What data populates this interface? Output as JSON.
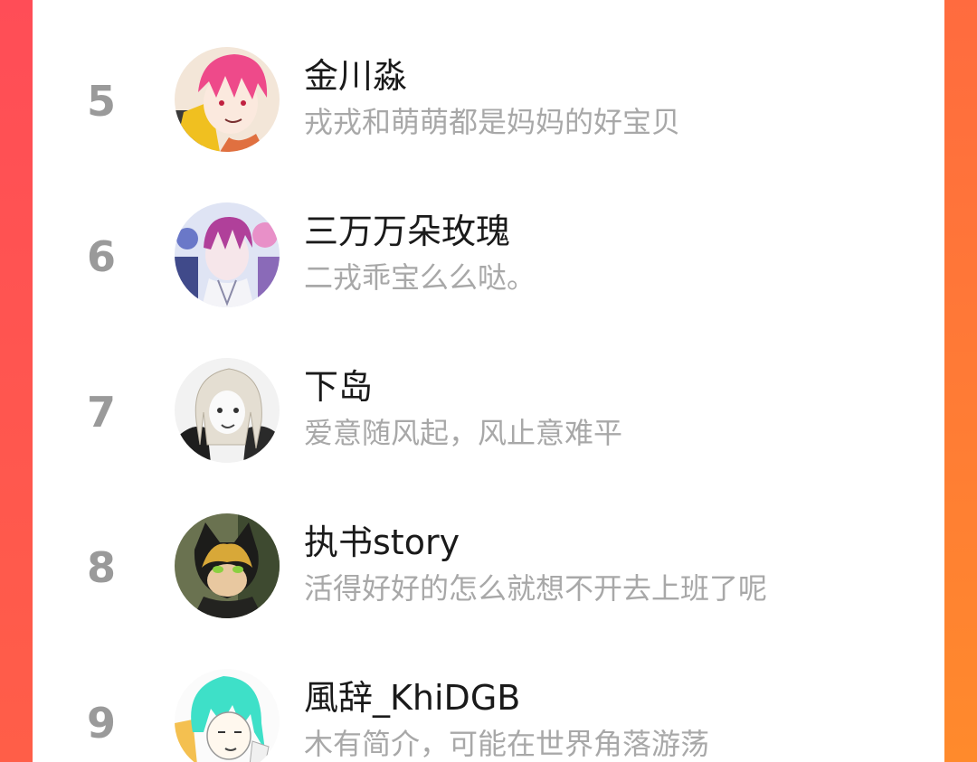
{
  "ranking": {
    "items": [
      {
        "rank": "5",
        "name": "金川淼",
        "bio": "戎戎和萌萌都是妈妈的好宝贝",
        "avatar": "avatar-pink-hair-anime"
      },
      {
        "rank": "6",
        "name": "三万万朵玫瑰",
        "bio": "二戎乖宝么么哒。",
        "avatar": "avatar-purple-hair-anime"
      },
      {
        "rank": "7",
        "name": "下岛",
        "bio": "爱意随风起，风止意难平",
        "avatar": "avatar-white-hair-sketch"
      },
      {
        "rank": "8",
        "name": "执书story",
        "bio": "活得好好的怎么就想不开去上班了呢",
        "avatar": "avatar-cat-mask-hero"
      },
      {
        "rank": "9",
        "name": "風辞_KhiDGB",
        "bio": "木有简介，可能在世界角落游荡",
        "avatar": "avatar-teal-hair-drawing"
      }
    ]
  },
  "colors": {
    "rank": "#9a9a9a",
    "name": "#1a1a1a",
    "bio": "#a8a8a8",
    "frame": "#ff5a4a"
  }
}
